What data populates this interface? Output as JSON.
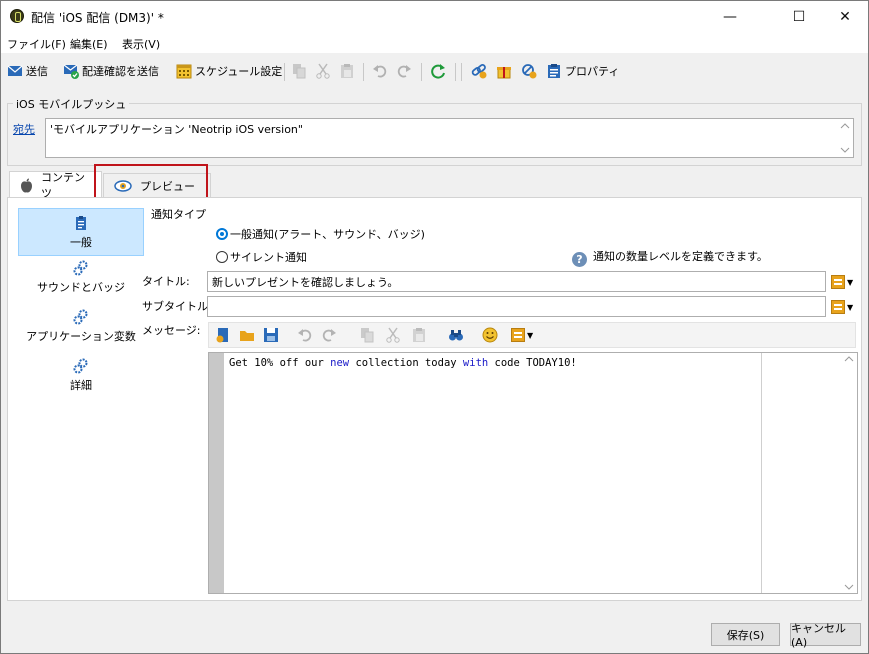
{
  "window": {
    "title": "配信 'iOS 配信 (DM3)' *",
    "controls": {
      "minimize": "—",
      "maximize": "☐",
      "close": "✕"
    }
  },
  "menu": [
    {
      "label": "ファイル(F)"
    },
    {
      "label": "編集(E)"
    },
    {
      "label": "表示(V)"
    }
  ],
  "toolbar": {
    "send": "送信",
    "send_proof": "配達確認を送信",
    "schedule": "スケジュール設定",
    "properties": "プロパティ"
  },
  "recipients": {
    "group_title": "iOS モバイルプッシュ",
    "link_label": "宛先",
    "value": "'モバイルアプリケーション 'Neotrip iOS version\""
  },
  "tabs": [
    {
      "label": "コンテンツ",
      "active": true
    },
    {
      "label": "プレビュー",
      "active": false
    }
  ],
  "sidebar": [
    {
      "label": "一般",
      "selected": true
    },
    {
      "label": "サウンドとバッジ",
      "selected": false
    },
    {
      "label": "アプリケーション変数",
      "selected": false
    },
    {
      "label": "詳細",
      "selected": false
    }
  ],
  "notification": {
    "type_label": "通知タイプ",
    "option_general": "一般通知(アラート、サウンド、バッジ)",
    "option_silent": "サイレント通知",
    "selected": "general",
    "help_text": "通知の数量レベルを定義できます。"
  },
  "fields": {
    "title_label": "タイトル:",
    "title_value": "新しいプレゼントを確認しましょう。",
    "subtitle_label": "サブタイトル:",
    "subtitle_value": "",
    "message_label": "メッセージ:"
  },
  "message": {
    "part1": "Get 10% off our ",
    "kw1": "new",
    "part2": " collection today ",
    "kw2": "with",
    "part3": " code TODAY10!"
  },
  "footer": {
    "save": "保存(S)",
    "cancel": "キャンセル(A)"
  }
}
